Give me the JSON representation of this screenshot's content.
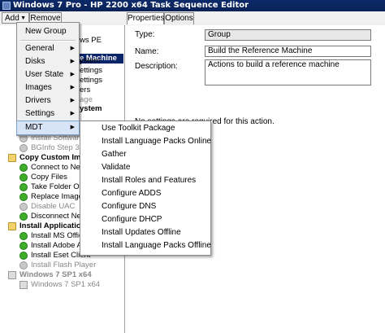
{
  "window": {
    "title": "Windows 7 Pro - HP 2200 x64 Task Sequence Editor"
  },
  "toolbar": {
    "add_label": "Add",
    "remove_label": "Remove"
  },
  "tree": {
    "selected_label": "e Machine",
    "rows": [
      {
        "label": "ws PE"
      },
      {
        "label": "ystem"
      },
      {
        "label": "ettings"
      },
      {
        "label": "ettings"
      },
      {
        "label": "ers"
      },
      {
        "label": "age"
      },
      {
        "label": "ystem"
      },
      {
        "label": "Install Software U"
      },
      {
        "label": "BGInfo Step 3"
      },
      {
        "label": "Copy Custom Imag"
      },
      {
        "label": "Connect to Netwo"
      },
      {
        "label": "Copy Files"
      },
      {
        "label": "Take Folder Owne"
      },
      {
        "label": "Replace Images"
      },
      {
        "label": "Disable UAC"
      },
      {
        "label": "Disconnect Netwo"
      },
      {
        "label": "Install Application"
      },
      {
        "label": "Install MS Office"
      },
      {
        "label": "Install Adobe Acr"
      },
      {
        "label": "Install Eset Client"
      },
      {
        "label": "Install Flash Player"
      },
      {
        "label": "Windows 7 SP1 x64"
      },
      {
        "label": "Windows 7 SP1 x64"
      }
    ]
  },
  "tabs": [
    {
      "label": "Properties"
    },
    {
      "label": "Options"
    }
  ],
  "properties": {
    "type_label": "Type:",
    "type_value": "Group",
    "name_label": "Name:",
    "name_value": "Build the Reference Machine",
    "description_label": "Description:",
    "description_value": "Actions to build a reference machine",
    "note": "No settings are required  for this action."
  },
  "context_menu": {
    "items": [
      {
        "label": "New Group"
      },
      {
        "label": "General"
      },
      {
        "label": "Disks"
      },
      {
        "label": "User State"
      },
      {
        "label": "Images"
      },
      {
        "label": "Drivers"
      },
      {
        "label": "Settings"
      },
      {
        "label": "MDT"
      }
    ]
  },
  "mdt_submenu": {
    "items": [
      {
        "label": "Use Toolkit Package"
      },
      {
        "label": "Install Language Packs Online"
      },
      {
        "label": "Gather"
      },
      {
        "label": "Validate"
      },
      {
        "label": "Install Roles and Features"
      },
      {
        "label": "Configure ADDS"
      },
      {
        "label": "Configure DNS"
      },
      {
        "label": "Configure DHCP"
      },
      {
        "label": "Install Updates Offline"
      },
      {
        "label": "Install Language Packs Offline"
      }
    ]
  }
}
